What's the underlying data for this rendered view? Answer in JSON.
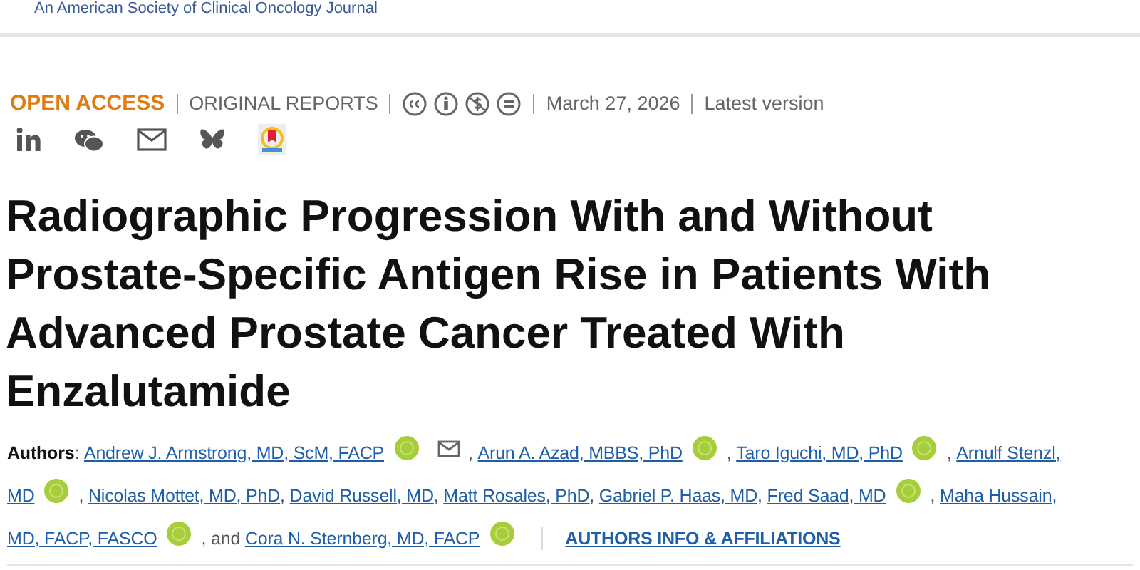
{
  "header": {
    "journal_tagline": "An American Society of Clinical Oncology Journal"
  },
  "meta": {
    "access": "OPEN ACCESS",
    "section": "ORIGINAL REPORTS",
    "date": "March 27, 2026",
    "version": "Latest version"
  },
  "title": "Radiographic Progression With and Without Prostate-Specific Antigen Rise in Patients With Advanced Prostate Cancer Treated With Enzalutamide",
  "author_lines": [
    [
      {
        "kind": "label",
        "text": "Authors"
      },
      {
        "kind": "text",
        "text": ": "
      },
      {
        "kind": "link",
        "text": "Andrew J. Armstrong, MD, ScM, FACP"
      },
      {
        "kind": "orcid"
      },
      {
        "kind": "email"
      },
      {
        "kind": "text",
        "text": ", "
      },
      {
        "kind": "link",
        "text": "Arun A. Azad, MBBS, PhD"
      },
      {
        "kind": "orcid"
      },
      {
        "kind": "text",
        "text": ", "
      },
      {
        "kind": "link",
        "text": "Taro Iguchi, MD, PhD"
      },
      {
        "kind": "orcid"
      },
      {
        "kind": "text",
        "text": ", "
      },
      {
        "kind": "link",
        "text": "Arnulf Stenzl,"
      }
    ],
    [
      {
        "kind": "link",
        "text": "MD"
      },
      {
        "kind": "orcid"
      },
      {
        "kind": "text",
        "text": ", "
      },
      {
        "kind": "link",
        "text": "Nicolas Mottet, MD, PhD"
      },
      {
        "kind": "text",
        "text": ", "
      },
      {
        "kind": "link",
        "text": "David Russell, MD"
      },
      {
        "kind": "text",
        "text": ", "
      },
      {
        "kind": "link",
        "text": "Matt Rosales, PhD"
      },
      {
        "kind": "text",
        "text": ", "
      },
      {
        "kind": "link",
        "text": "Gabriel P. Haas, MD"
      },
      {
        "kind": "text",
        "text": ", "
      },
      {
        "kind": "link",
        "text": "Fred Saad, MD"
      },
      {
        "kind": "orcid"
      },
      {
        "kind": "text",
        "text": ", "
      },
      {
        "kind": "link",
        "text": "Maha Hussain,"
      }
    ],
    [
      {
        "kind": "link",
        "text": "MD, FACP, FASCO"
      },
      {
        "kind": "orcid"
      },
      {
        "kind": "text",
        "text": ", and "
      },
      {
        "kind": "link",
        "text": "Cora N. Sternberg, MD, FACP"
      },
      {
        "kind": "orcid"
      },
      {
        "kind": "divider"
      },
      {
        "kind": "action",
        "text": "AUTHORS INFO & AFFILIATIONS"
      }
    ]
  ]
}
